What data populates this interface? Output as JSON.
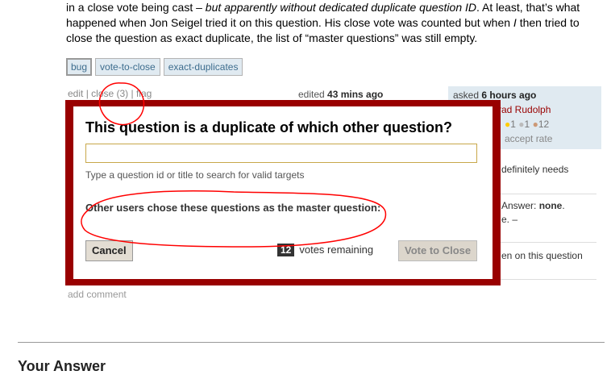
{
  "post": {
    "line1_start": "in a close vote being cast – ",
    "line1_em": "but apparently without dedicated duplicate question ID",
    "line1_end": ". At least, that’s what",
    "line2_pre": "happened when Jon Seigel tried it on this question. His close vote was counted but when ",
    "line2_em": "I",
    "line2_post": " then tried to",
    "line3": "close the question as exact duplicate, the list of “master questions” was still empty."
  },
  "tags": [
    "bug",
    "vote-to-close",
    "exact-duplicates"
  ],
  "post_menu": {
    "edit": "edit",
    "sep1": " | ",
    "close": "close (3)",
    "sep2": " | ",
    "flag": "flag"
  },
  "edited": {
    "label": "edited ",
    "time": "43 mins ago"
  },
  "owner": {
    "asked_label": "asked ",
    "asked_time": "6 hours ago",
    "name": "rad Rudolph",
    "gold": "●",
    "gold_count": "1",
    "silver": "●",
    "silver_count": "1",
    "bronze": "●",
    "bronze_count": "12",
    "accept": "accept rate"
  },
  "side_notes": {
    "n1": "definitely needs",
    "n2_pre": "Answer: ",
    "n2_bold": "none",
    "n2_post": ".",
    "n3": "e. –",
    "n4": "en on this question"
  },
  "modal": {
    "title": "This question is a duplicate of which other question?",
    "input_value": "",
    "hint": "Type a question id or title to search for valid targets",
    "others": "Other users chose these questions as the master question:",
    "cancel": "Cancel",
    "votes_count": "12",
    "votes_label": "votes remaining",
    "vote_button": "Vote to Close"
  },
  "add_comment": "add comment",
  "your_answer": "Your Answer",
  "colors": {
    "modal_border": "#990000",
    "annotation": "#ff0000",
    "owner_bg": "#e0eaf1"
  }
}
